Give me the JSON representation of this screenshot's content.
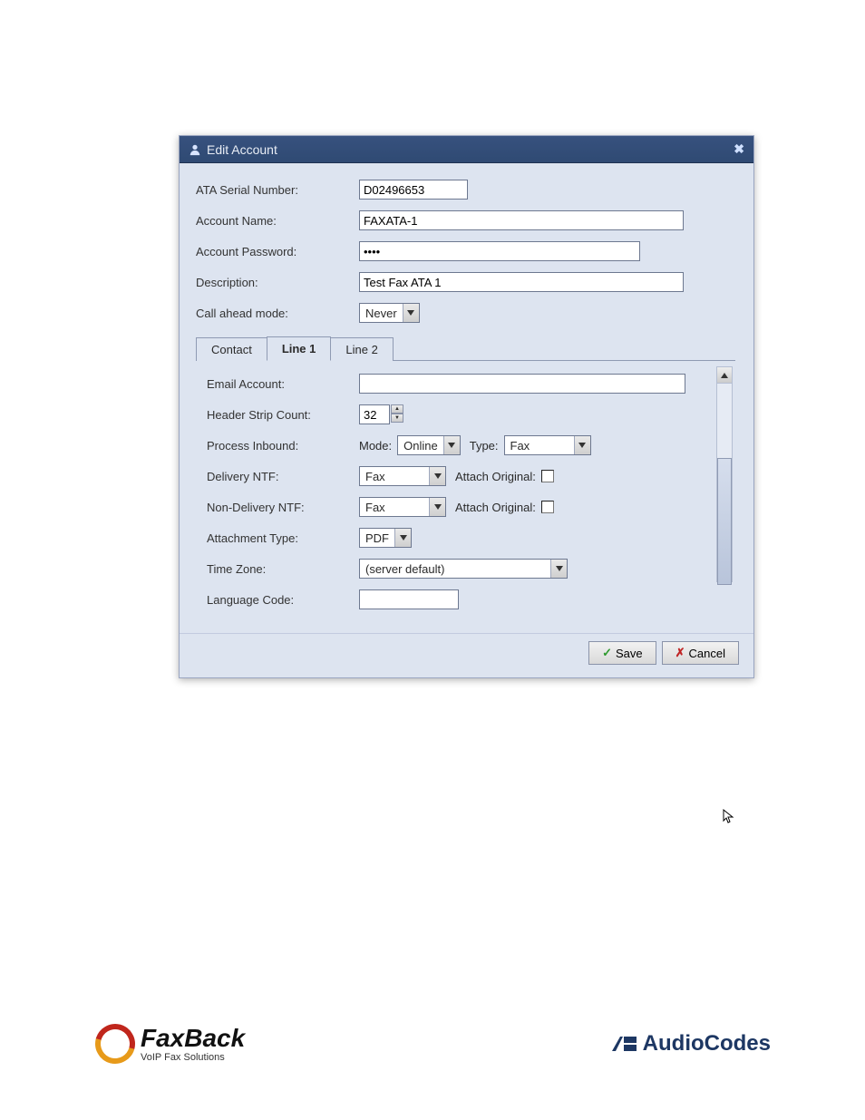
{
  "dialog": {
    "title": "Edit Account",
    "fields": {
      "ata_serial_label": "ATA Serial Number:",
      "ata_serial_value": "D02496653",
      "account_name_label": "Account Name:",
      "account_name_value": "FAXATA-1",
      "account_password_label": "Account Password:",
      "account_password_value": "••••",
      "description_label": "Description:",
      "description_value": "Test Fax ATA 1",
      "call_ahead_label": "Call ahead mode:",
      "call_ahead_value": "Never"
    },
    "tabs": {
      "contact": "Contact",
      "line1": "Line 1",
      "line2": "Line 2"
    },
    "line1": {
      "email_account_label": "Email Account:",
      "email_account_value": "",
      "header_strip_label": "Header Strip Count:",
      "header_strip_value": "32",
      "process_inbound_label": "Process Inbound:",
      "mode_label": "Mode:",
      "mode_value": "Online",
      "type_label": "Type:",
      "type_value": "Fax",
      "delivery_ntf_label": "Delivery NTF:",
      "delivery_ntf_value": "Fax",
      "attach_original_label": "Attach Original:",
      "non_delivery_ntf_label": "Non-Delivery NTF:",
      "non_delivery_ntf_value": "Fax",
      "attachment_type_label": "Attachment Type:",
      "attachment_type_value": "PDF",
      "time_zone_label": "Time Zone:",
      "time_zone_value": "(server default)",
      "language_code_label": "Language Code:",
      "language_code_value": ""
    },
    "buttons": {
      "save": "Save",
      "cancel": "Cancel"
    }
  },
  "footer": {
    "faxback_main": "FaxBack",
    "faxback_sub": "VoIP Fax Solutions",
    "audiocodes": "AudioCodes"
  }
}
